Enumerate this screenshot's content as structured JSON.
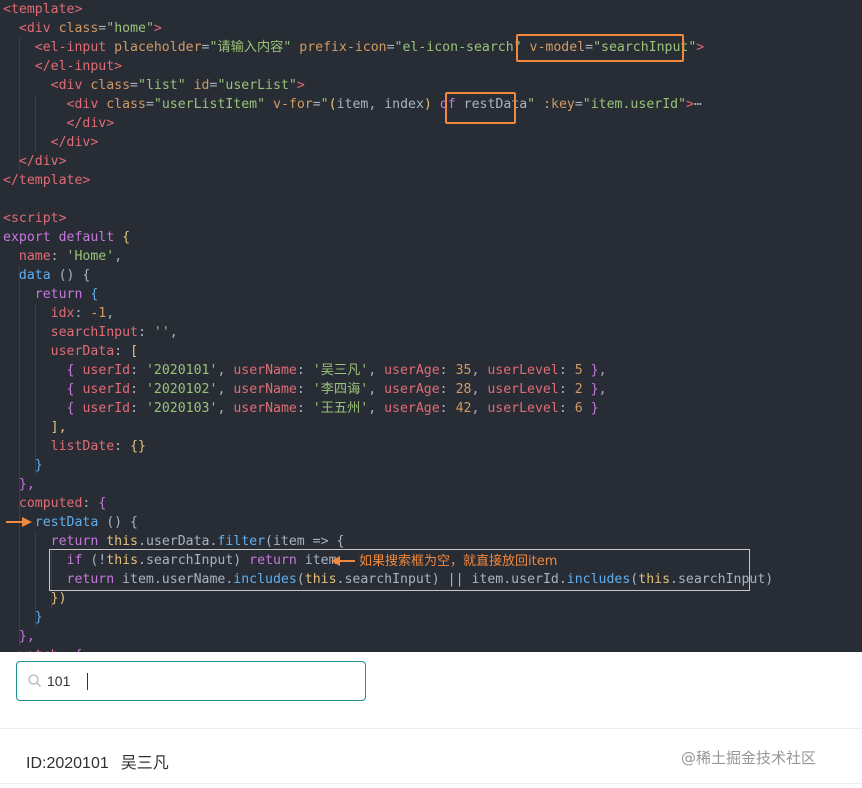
{
  "code": {
    "l1_tag": "<template>",
    "l2": {
      "open": "<div ",
      "attr": "class",
      "eq": "=",
      "val": "\"home\"",
      "close": ">"
    },
    "l3": {
      "open": "<el-input ",
      "a1": "placeholder",
      "v1": "\"请输入内容\"",
      "a2": "prefix-icon",
      "v2": "\"el-icon-search\"",
      "a3": "v-model",
      "v3": "\"searchInput\"",
      "close": ">"
    },
    "l4": "</el-input>",
    "l5": {
      "open": "<div ",
      "a1": "class",
      "v1": "\"list\"",
      "a2": "id",
      "v2": "\"userList\"",
      "close": ">"
    },
    "l6": {
      "open": "<div ",
      "a1": "class",
      "v1": "\"userListItem\"",
      "a2": "v-for",
      "eq": "=",
      "q1": "\"",
      "p1": "(",
      "x1": "item",
      "c": ", ",
      "x2": "index",
      "p2": ")",
      "of": " of ",
      "x3": "restData",
      "q2": "\"",
      "a3": ":key",
      "v3": "\"item.userId\"",
      "close": ">",
      "ellipsis": "⋯"
    },
    "l7": "</div>",
    "l8": "</div>",
    "l9": "</div>",
    "l10": "</template>",
    "l12": "<script>",
    "l13": {
      "k1": "export",
      "k2": "default",
      "b": "{"
    },
    "l14": {
      "prop": "name",
      "val": "'Home'"
    },
    "l15": {
      "fn": "data",
      "rest": " () {"
    },
    "l16": {
      "k": "return",
      "b": "{"
    },
    "l17": {
      "prop": "idx",
      "val": "-1"
    },
    "l18": {
      "prop": "searchInput",
      "val": "''"
    },
    "l19": {
      "prop": "userData",
      "b": "["
    },
    "users": [
      {
        "id": "'2020101'",
        "name": "'吴三凡'",
        "age": "35",
        "level": "5"
      },
      {
        "id": "'2020102'",
        "name": "'李四诲'",
        "age": "28",
        "level": "2"
      },
      {
        "id": "'2020103'",
        "name": "'王五州'",
        "age": "42",
        "level": "6"
      }
    ],
    "keys": {
      "id": "userId",
      "name": "userName",
      "age": "userAge",
      "level": "userLevel"
    },
    "l23": "],",
    "l24": {
      "prop": "listDate",
      "val": "{}"
    },
    "l25": "}",
    "l26": "},",
    "l27": {
      "prop": "computed",
      "b": "{"
    },
    "l28": {
      "fn": "restData",
      "rest": " () {"
    },
    "l29": {
      "k": "return",
      "this": "this",
      "p1": ".userData.",
      "fn": "filter",
      "rest": "(item => {"
    },
    "l30": {
      "k1": "if",
      "a": " (!",
      "this": "this",
      "b": ".searchInput) ",
      "k2": "return",
      "c": " item"
    },
    "l31": {
      "k": "return",
      "a": " item.userName.",
      "fn": "includes",
      "b": "(",
      "this": "this",
      "c": ".searchInput) || item.userId.",
      "fn2": "includes",
      "d": "(",
      "this2": "this",
      "e": ".searchInput)"
    },
    "l32": "})",
    "l33": "}",
    "l34": "},",
    "l35": {
      "prop": "watch",
      "b": "{"
    }
  },
  "annotation": "如果搜索框为空，就直接放回item",
  "preview": {
    "search_value": "101",
    "result_id": "ID:2020101",
    "result_name": "吴三凡"
  },
  "watermark": "@稀土掘金技术社区",
  "colors": {
    "highlight": "#f0883e",
    "editor_bg": "#282c34",
    "input_border": "#1f8f8f"
  }
}
